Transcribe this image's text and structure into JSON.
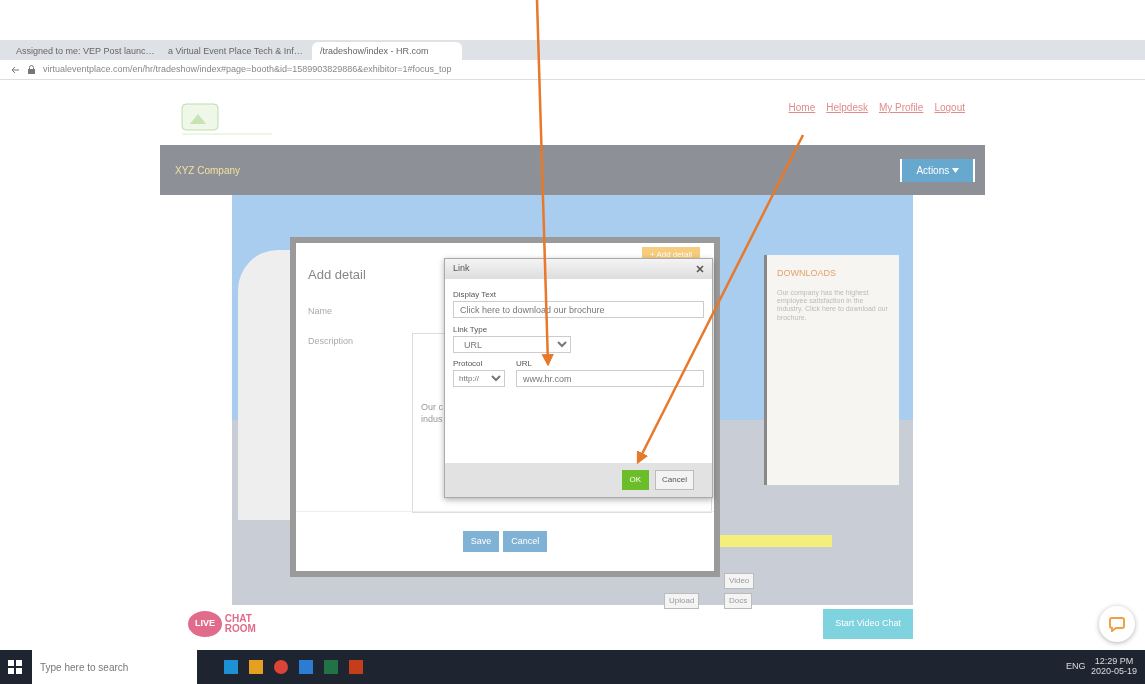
{
  "browser": {
    "tabs": [
      {
        "title": "Assigned to me: VEP Post launc…",
        "selected": false
      },
      {
        "title": "a Virtual Event Place Tech & Inf…",
        "selected": false
      },
      {
        "title": "/tradeshow/index - HR.com",
        "selected": true
      }
    ],
    "address": "virtualeventplace.com/en/hr/tradeshow/index#page=booth&id=1589903829886&exhibitor=1#focus_top"
  },
  "header": {
    "nav_links": [
      "Home",
      "Helpdesk",
      "My Profile",
      "Logout"
    ]
  },
  "company_bar": {
    "name": "XYZ Company",
    "actions": "Actions"
  },
  "booth": {
    "add_detail": "+ Add detail",
    "downloads_title": "DOWNLOADS",
    "downloads_text": "Our company has the highest employee satisfaction in the industry. Click here to download our brochure.",
    "buttons": [
      "Video",
      "Docs"
    ],
    "upload": "Upload"
  },
  "add_detail": {
    "title": "Add detail",
    "fields": [
      "Name",
      "Description"
    ],
    "description_lines": [
      "Our c",
      "indus"
    ],
    "save": "Save",
    "cancel": "Cancel"
  },
  "link_dialog": {
    "title": "Link",
    "display_text_label": "Display Text",
    "display_text": "Click here to download our brochure",
    "link_type_label": "Link Type",
    "link_type": "URL",
    "protocol_label": "Protocol",
    "protocol": "http://",
    "url_label": "URL",
    "url": "www.hr.com",
    "ok": "OK",
    "cancel": "Cancel"
  },
  "footer": {
    "chat_logo": [
      "LIVE",
      "CHAT",
      "ROOM"
    ],
    "video_chat": "Start Video Chat"
  },
  "taskbar": {
    "search_placeholder": "Type here to search",
    "language": "ENG",
    "time": "12:29 PM",
    "date": "2020-05-19"
  }
}
